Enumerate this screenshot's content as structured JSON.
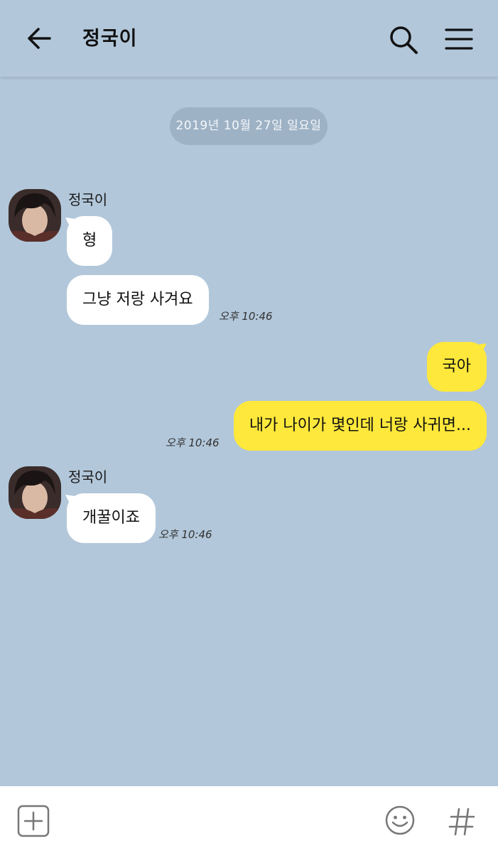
{
  "header": {
    "title": "정국이",
    "back_icon": "arrow-left-icon",
    "search_icon": "search-icon",
    "menu_icon": "hamburger-menu-icon"
  },
  "chat": {
    "date_divider": "2019년 10월 27일 일요일",
    "messages": [
      {
        "sender": "정국이",
        "direction": "incoming",
        "text": "형",
        "time": ""
      },
      {
        "sender": "정국이",
        "direction": "incoming",
        "text": "그냥 저랑 사겨요",
        "time": "오후 10:46"
      },
      {
        "sender": "me",
        "direction": "outgoing",
        "text": "국아",
        "time": ""
      },
      {
        "sender": "me",
        "direction": "outgoing",
        "text": "내가 나이가 몇인데 너랑 사귀면...",
        "time": "오후 10:46"
      },
      {
        "sender": "정국이",
        "direction": "incoming",
        "text": "개꿀이죠",
        "time": "오후 10:46"
      }
    ],
    "sender_label_1": "정국이",
    "sender_label_2": "정국이"
  },
  "bottom_bar": {
    "attach_icon": "plus-square-icon",
    "emoji_icon": "smiley-icon",
    "hashtag_icon": "hashtag-icon"
  },
  "colors": {
    "background": "#b2c7da",
    "incoming_bubble": "#ffffff",
    "outgoing_bubble": "#fee83b"
  }
}
